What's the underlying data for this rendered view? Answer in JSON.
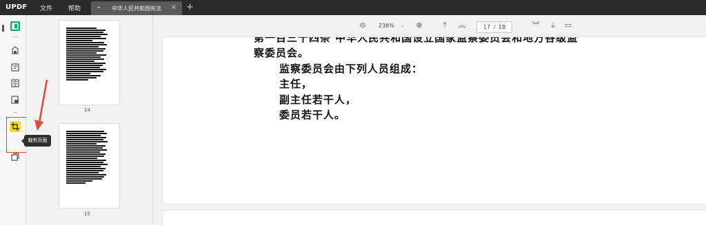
{
  "app": {
    "logo_main": "UPDF",
    "menu": [
      "文件",
      "帮助"
    ],
    "tab": {
      "title": "中华人民共和国宪法"
    }
  },
  "toolbar": {
    "zoom": "238%",
    "current_page": "17",
    "separator": "/",
    "total_pages": "18"
  },
  "thumbnails": [
    {
      "page_number": "14"
    },
    {
      "page_number": "15"
    }
  ],
  "tooltip": "裁剪页面",
  "document": {
    "lines": [
      "第一百三十四条 中华人民共和国设立国家监察委员会和地方各级监",
      "察委员会。",
      "监察委员会由下列人员组成：",
      "主任，",
      "副主任若干人，",
      "委员若干人。"
    ]
  },
  "colors": {
    "titlebar": "#2b2b2b",
    "accent_logo": "#ffb300",
    "active_tool": "#fde100",
    "highlight": "#e0483a",
    "reader_icon": "#1aa86b"
  },
  "icons": [
    "reader-icon",
    "edit-icon",
    "comment-icon",
    "organize-icon",
    "convert-icon",
    "protect-icon",
    "crop-icon",
    "copy-icon",
    "zoom-out-icon",
    "zoom-in-icon",
    "first-page-icon",
    "prev-page-icon",
    "next-page-icon",
    "last-page-icon",
    "comment-view-icon"
  ]
}
